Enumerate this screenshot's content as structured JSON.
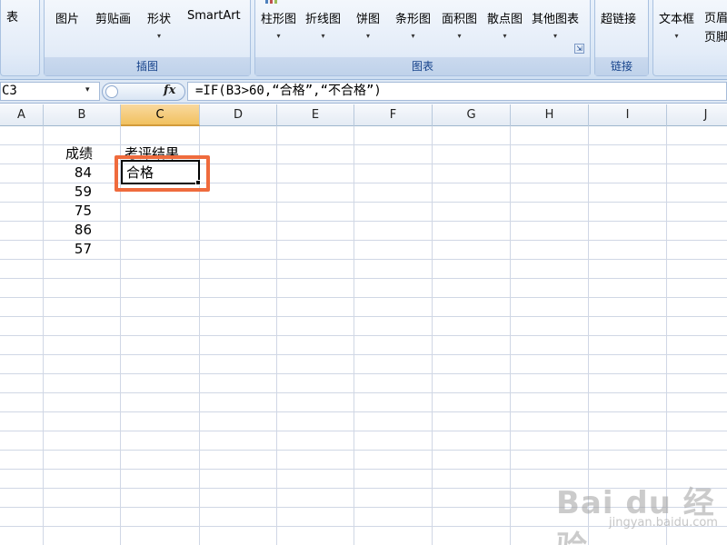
{
  "ribbon": {
    "tables_group": {
      "partial_label": "表"
    },
    "illustrations": {
      "label": "插图",
      "picture": "图片",
      "clipart": "剪贴画",
      "shapes": "形状",
      "smartart": "SmartArt"
    },
    "charts": {
      "label": "图表",
      "column": "柱形图",
      "line": "折线图",
      "pie": "饼图",
      "bar": "条形图",
      "area": "面积图",
      "scatter": "散点图",
      "other": "其他图表"
    },
    "links": {
      "label": "链接",
      "hyperlink": "超链接"
    },
    "text": {
      "textbox": "文本框",
      "header_footer_1": "页眉",
      "header_footer_2": "页脚"
    },
    "dropdown_glyph": "▾",
    "launcher_glyph": "⇲"
  },
  "formula_bar": {
    "name_box": "C3",
    "name_arrow": "▾",
    "fx_label": "fx",
    "formula": "=IF(B3>60,“合格”,“不合格”)"
  },
  "grid": {
    "column_headers": [
      "A",
      "B",
      "C",
      "D",
      "E",
      "F",
      "G",
      "H",
      "I",
      "J"
    ],
    "selected_column": "C",
    "b_header": "成绩",
    "c_header": "考评结果",
    "scores": [
      "84",
      "59",
      "75",
      "86",
      "57"
    ],
    "c3_value": "合格"
  },
  "watermark": {
    "brand": "Bai du 经验",
    "sub": "jingyan.baidu.com"
  },
  "colors": {
    "highlight": "#ef6b3d",
    "selected_header": "#f1c15f",
    "ribbon_text": "#15428b",
    "gridline": "#d0d7e5"
  }
}
